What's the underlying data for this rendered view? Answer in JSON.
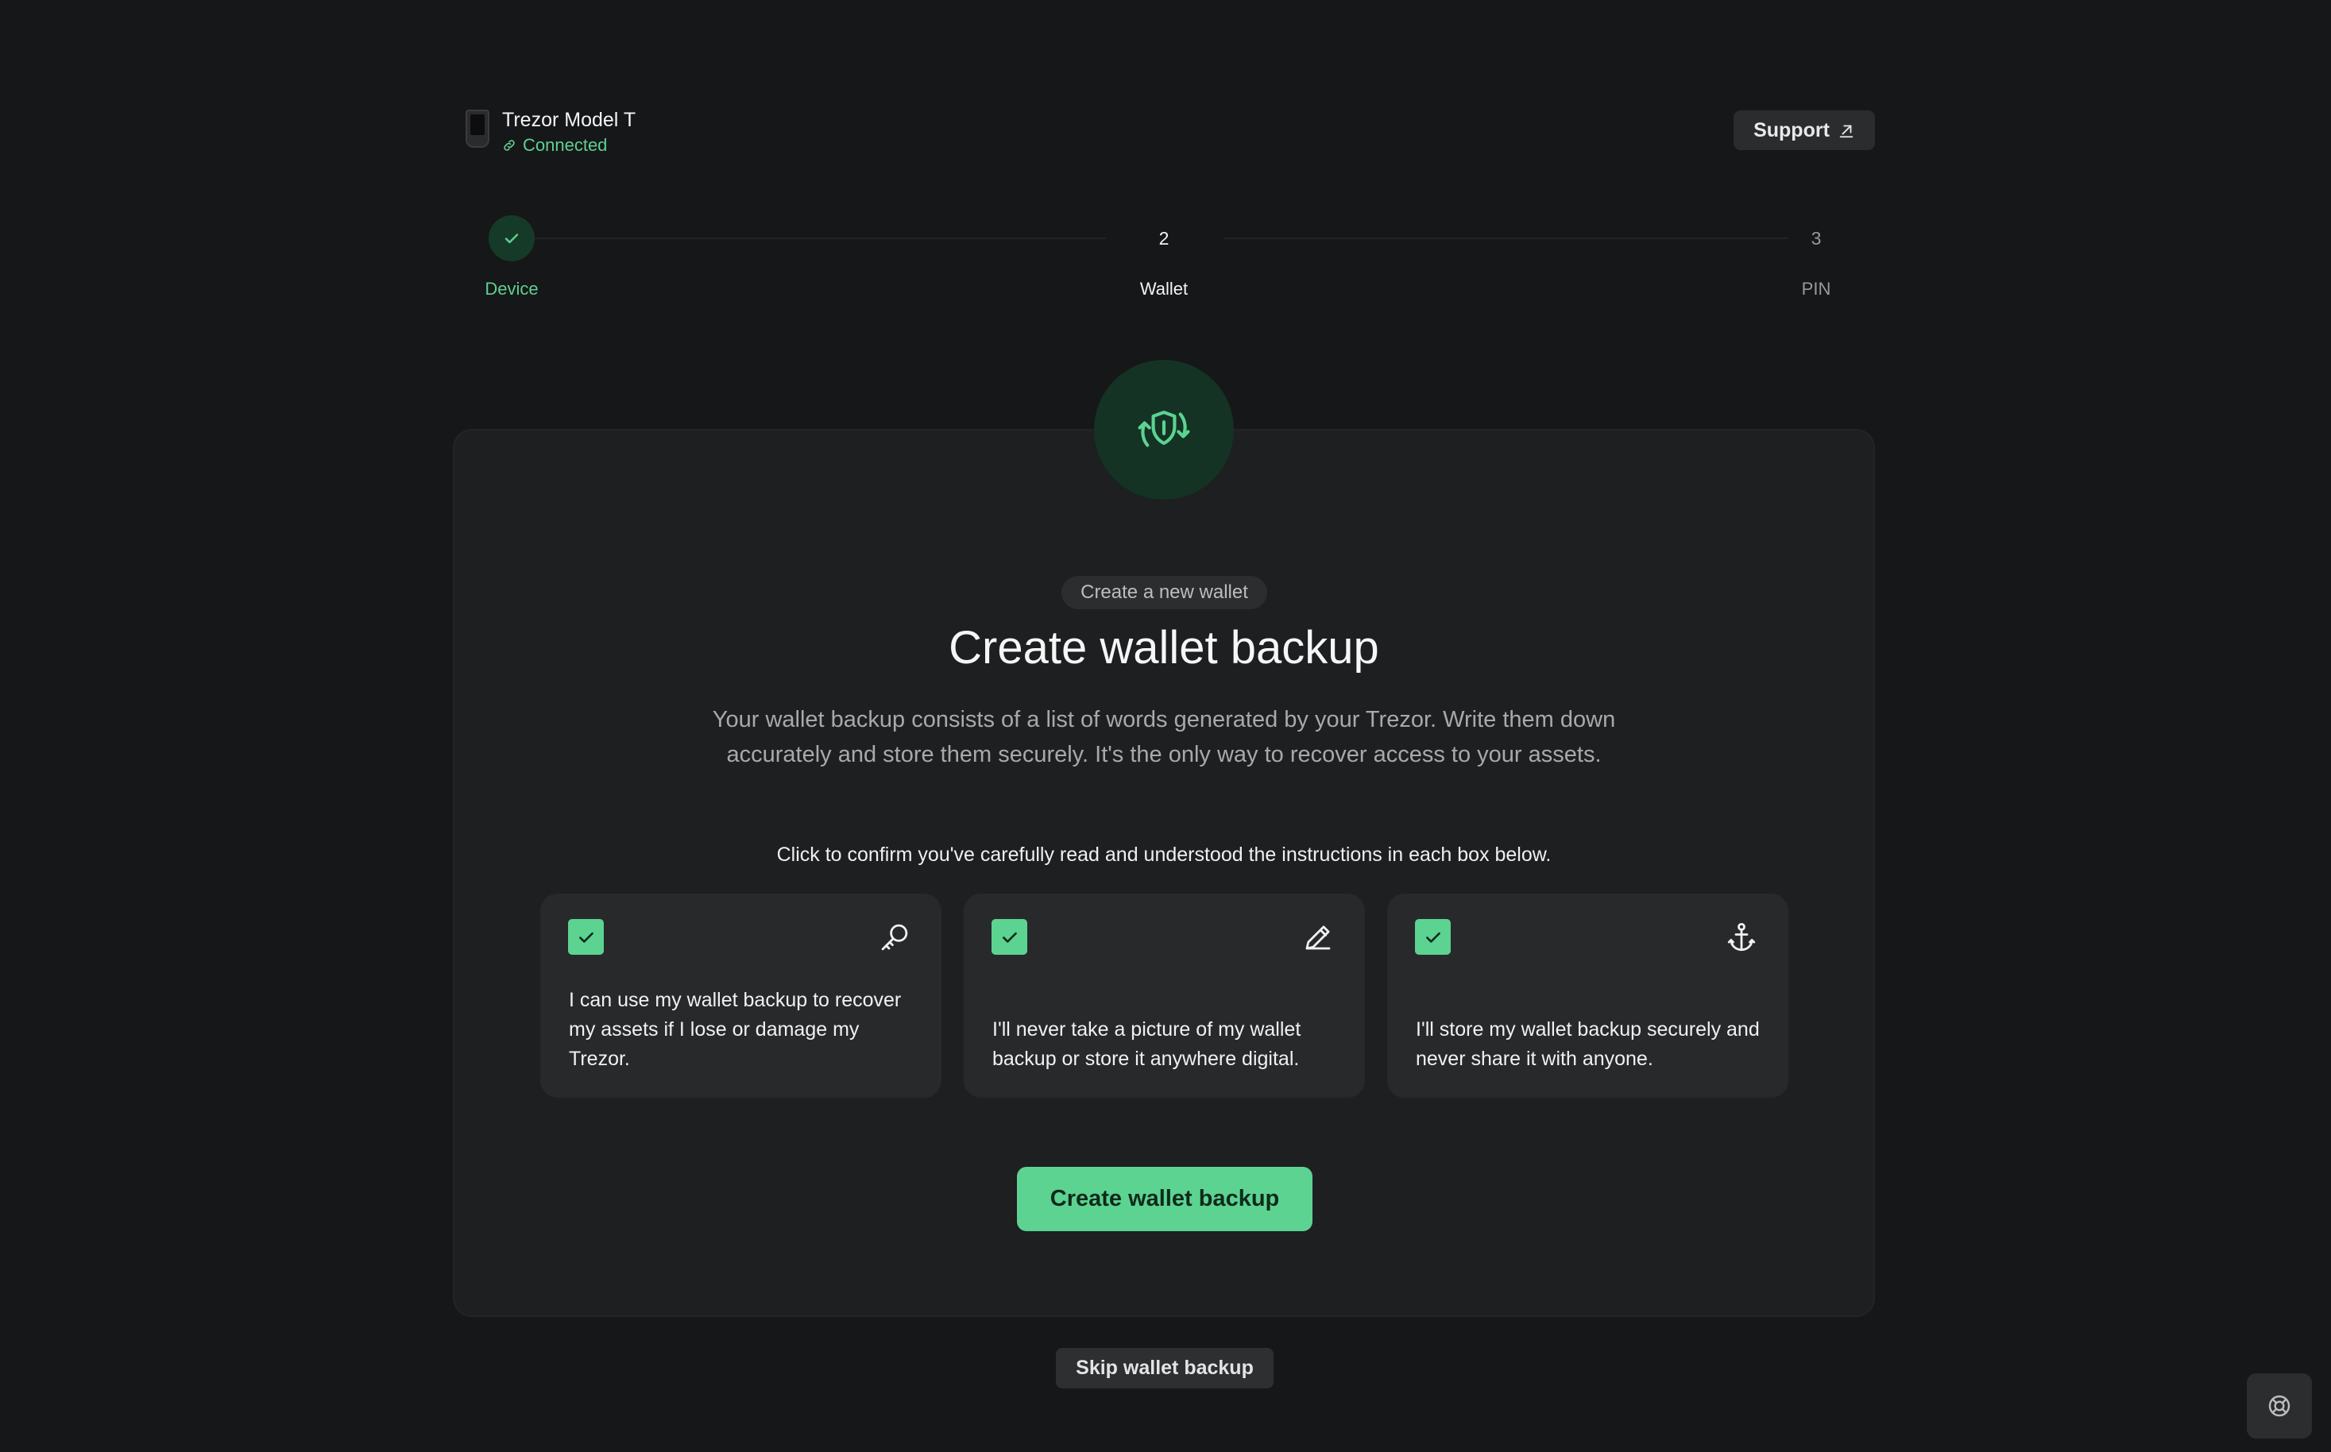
{
  "device": {
    "name": "Trezor Model T",
    "status": "Connected"
  },
  "support": {
    "label": "Support",
    "icon": "external-link-icon"
  },
  "steps": [
    {
      "label": "Device",
      "number": "",
      "state": "done"
    },
    {
      "label": "Wallet",
      "number": "2",
      "state": "current"
    },
    {
      "label": "PIN",
      "number": "3",
      "state": "upcoming"
    }
  ],
  "main": {
    "hero_icon": "shield-sync-icon",
    "pill": "Create a new wallet",
    "title": "Create wallet backup",
    "description": "Your wallet backup consists of a list of words generated by your Trezor. Write them down accurately and store them securely. It's the only way to recover access to your assets.",
    "instruction": "Click to confirm you've carefully read and understood the instructions in each box below.",
    "boxes": [
      {
        "text": "I can use my wallet backup to recover my assets if I lose or damage my Trezor.",
        "icon": "key-icon",
        "checked": true
      },
      {
        "text": "I'll never take a picture of my wallet backup or store it anywhere digital.",
        "icon": "pencil-icon",
        "checked": true
      },
      {
        "text": "I'll store my wallet backup securely and never share it with anyone.",
        "icon": "anchor-icon",
        "checked": true
      }
    ],
    "primary_button": "Create wallet backup"
  },
  "skip_button": "Skip wallet backup",
  "colors": {
    "accent": "#5cd391",
    "accent_text": "#5fcf92",
    "background": "#161718",
    "card": "#1e1f21"
  }
}
